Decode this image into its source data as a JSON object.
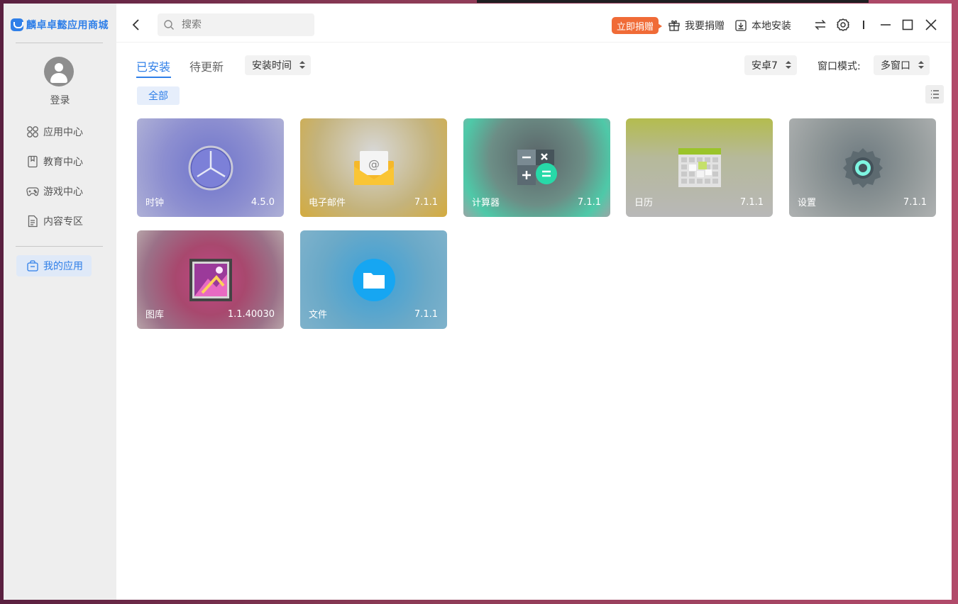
{
  "sidebar": {
    "logo_text": "麟卓卓懿应用商城",
    "login_label": "登录",
    "items": [
      {
        "label": "应用中心",
        "icon": "grid-icon"
      },
      {
        "label": "教育中心",
        "icon": "book-icon"
      },
      {
        "label": "游戏中心",
        "icon": "gamepad-icon"
      },
      {
        "label": "内容专区",
        "icon": "document-icon"
      },
      {
        "label": "我的应用",
        "icon": "bag-icon",
        "active": true
      }
    ]
  },
  "header": {
    "search_placeholder": "搜索",
    "donate_now": "立即捐赠",
    "donate_label": "我要捐赠",
    "local_install_label": "本地安装"
  },
  "toolbar": {
    "tabs": [
      {
        "label": "已安装",
        "active": true
      },
      {
        "label": "待更新",
        "active": false
      }
    ],
    "sort_select": "安装时间",
    "android_select": "安卓7",
    "window_mode_label": "窗口模式:",
    "window_mode_select": "多窗口",
    "filter_chip": "全部"
  },
  "apps": [
    {
      "name": "时钟",
      "version": "4.5.0",
      "icon": "clock-icon"
    },
    {
      "name": "电子邮件",
      "version": "7.1.1",
      "icon": "email-icon"
    },
    {
      "name": "计算器",
      "version": "7.1.1",
      "icon": "calculator-icon"
    },
    {
      "name": "日历",
      "version": "7.1.1",
      "icon": "calendar-icon"
    },
    {
      "name": "设置",
      "version": "7.1.1",
      "icon": "settings-icon"
    },
    {
      "name": "图库",
      "version": "1.1.40030",
      "icon": "gallery-icon"
    },
    {
      "name": "文件",
      "version": "7.1.1",
      "icon": "files-icon"
    }
  ],
  "colors": {
    "accent": "#2f7fe8",
    "donate": "#f06b37",
    "sidebar_bg": "#eeeeee"
  }
}
